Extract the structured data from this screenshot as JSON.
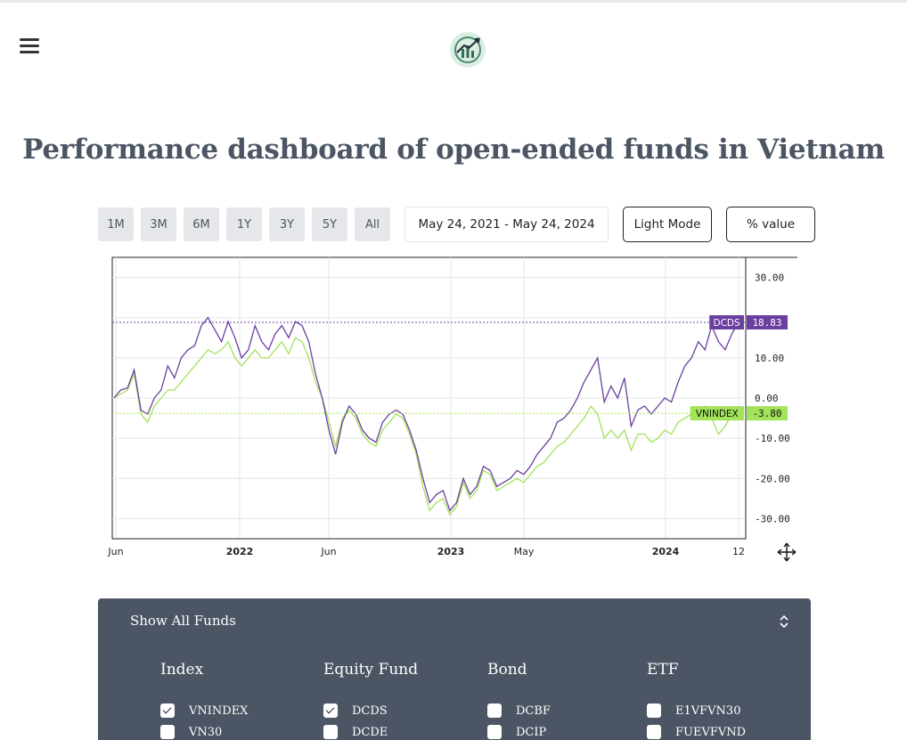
{
  "header": {
    "menu_icon": "hamburger-menu-icon",
    "logo_icon": "chart-logo-icon"
  },
  "page": {
    "title": "Performance dashboard of open-ended funds in Vietnam"
  },
  "controls": {
    "ranges": [
      "1M",
      "3M",
      "6M",
      "1Y",
      "3Y",
      "5Y",
      "All"
    ],
    "date_range": "May 24, 2021 - May 24, 2024",
    "theme_button": "Light Mode",
    "mode_button": "% value"
  },
  "colors": {
    "dcds": "#6b3fa0",
    "vnindex": "#a3e35a",
    "panel": "#4b5563"
  },
  "chart_data": {
    "type": "line",
    "x_ticks": [
      "Jun",
      "2022",
      "Jun",
      "2023",
      "May",
      "2024",
      "12"
    ],
    "y_ticks": [
      "30.00",
      "10.00",
      "0.00",
      "-10.00",
      "-20.00",
      "-30.00"
    ],
    "ylim": [
      -35,
      35
    ],
    "grid": true,
    "series": [
      {
        "name": "DCDS",
        "last_label": "18.83",
        "values": [
          0,
          2,
          2.5,
          7,
          -3,
          -4,
          0,
          2,
          8,
          5,
          10,
          12,
          13,
          18,
          20,
          17,
          14,
          19,
          15,
          10,
          12,
          18,
          14,
          12,
          16,
          18,
          15,
          19,
          18,
          14,
          6,
          0,
          -8,
          -14,
          -6,
          -2,
          -4,
          -8,
          -10,
          -11,
          -6,
          -4,
          -3,
          -4,
          -8,
          -13,
          -20,
          -26,
          -24,
          -23,
          -28,
          -26,
          -20,
          -24,
          -22,
          -17,
          -18,
          -22,
          -21,
          -20,
          -18,
          -19,
          -17,
          -14,
          -12,
          -10,
          -6,
          -5,
          -3,
          0,
          4,
          7,
          10,
          -1,
          3,
          0,
          5,
          -7,
          -3,
          -2,
          -4,
          -2,
          0,
          -1,
          4,
          8,
          10,
          14,
          12,
          18,
          14,
          12,
          16,
          18.83
        ]
      },
      {
        "name": "VNINDEX",
        "last_label": "-3.80",
        "values": [
          0,
          1,
          2,
          6,
          -4,
          -6,
          -2,
          0,
          2,
          2,
          4,
          6,
          8,
          10,
          12,
          11,
          12,
          14,
          10,
          8,
          10,
          12,
          10,
          10,
          12,
          14,
          11,
          15,
          14,
          10,
          4,
          0,
          -6,
          -12,
          -5,
          -3,
          -5,
          -9,
          -11,
          -12,
          -8,
          -6,
          -4,
          -5,
          -9,
          -14,
          -22,
          -28,
          -26,
          -25,
          -29,
          -27,
          -21,
          -25,
          -23,
          -18,
          -19,
          -23,
          -22,
          -21,
          -20,
          -21,
          -19,
          -17,
          -16,
          -14,
          -12,
          -11,
          -9,
          -7,
          -5,
          -2,
          -4,
          -10,
          -8,
          -10,
          -8,
          -13,
          -9,
          -9,
          -11,
          -10,
          -8,
          -9,
          -6,
          -5,
          -4,
          -3,
          -2,
          -5,
          -9,
          -7,
          -4,
          -3.8
        ]
      }
    ]
  },
  "panel": {
    "title": "Show All Funds",
    "toggle_icon": "chevron-up-down-icon",
    "categories": [
      {
        "label": "Index",
        "items": [
          {
            "label": "VNINDEX",
            "checked": true
          },
          {
            "label": "VN30",
            "checked": false
          }
        ]
      },
      {
        "label": "Equity Fund",
        "items": [
          {
            "label": "DCDS",
            "checked": true
          },
          {
            "label": "DCDE",
            "checked": false
          }
        ]
      },
      {
        "label": "Bond",
        "items": [
          {
            "label": "DCBF",
            "checked": false
          },
          {
            "label": "DCIP",
            "checked": false
          }
        ]
      },
      {
        "label": "ETF",
        "items": [
          {
            "label": "E1VFVN30",
            "checked": false
          },
          {
            "label": "FUEVFVND",
            "checked": false
          }
        ]
      }
    ]
  }
}
